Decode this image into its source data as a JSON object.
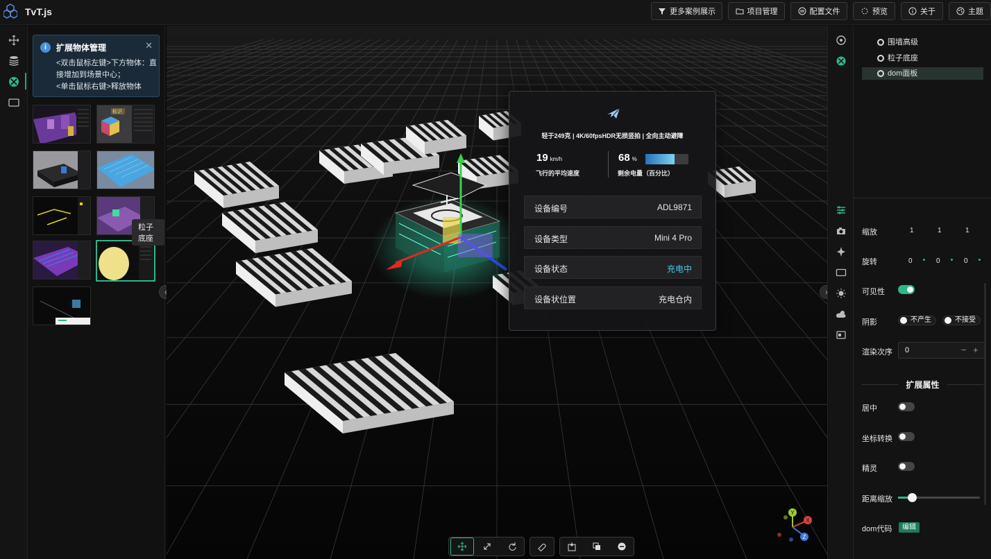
{
  "app": {
    "title": "TvT.js"
  },
  "toolbar": {
    "buttons": [
      {
        "label": "更多案例展示",
        "icon": "filter-icon"
      },
      {
        "label": "项目管理",
        "icon": "folder-icon"
      },
      {
        "label": "配置文件",
        "icon": "config-icon"
      },
      {
        "label": "预览",
        "icon": "preview-icon"
      },
      {
        "label": "关于",
        "icon": "info-icon"
      },
      {
        "label": "主题",
        "icon": "theme-icon"
      }
    ]
  },
  "left_panel": {
    "info": {
      "title": "扩展物体管理",
      "lines": [
        "<双击鼠标左键>下方物体：直",
        "接增加到场景中心；",
        "<单击鼠标右键>释放物体"
      ]
    },
    "thumb_tag": "标识",
    "tooltip": "粒子底座"
  },
  "device_popup": {
    "subtitle": "轻于249克 | 4K/60fpsHDR无损竖拍 | 全向主动避障",
    "speed": {
      "value": "19",
      "unit": "km/h",
      "label": "飞行的平均速度"
    },
    "battery": {
      "value": "68",
      "unit": "%",
      "label": "剩余电量（百分比）",
      "percent": 68
    },
    "rows": [
      {
        "key": "设备编号",
        "value": "ADL9871"
      },
      {
        "key": "设备类型",
        "value": "Mini 4 Pro"
      },
      {
        "key": "设备状态",
        "value": "充电中"
      },
      {
        "key": "设备状位置",
        "value": "充电仓内"
      }
    ]
  },
  "right_panel": {
    "tree": [
      "围墙高级",
      "粒子底座",
      "dom面板"
    ],
    "props": {
      "scale_label": "缩放",
      "scale": [
        "1",
        "1",
        "1"
      ],
      "rotate_label": "旋转",
      "rotate": [
        "0",
        "0",
        "0"
      ],
      "visible_label": "可见性",
      "shadow_label": "阴影",
      "shadow_cast": "不产生",
      "shadow_receive": "不接受",
      "render_order_label": "渲染次序",
      "render_order": "0",
      "render_minus": "−",
      "render_plus": "+"
    },
    "extend": {
      "title": "扩展属性",
      "center_label": "居中",
      "coord_label": "坐标转换",
      "sprite_label": "精灵",
      "distance_label": "距离缩放",
      "distance_value": 0.17,
      "dom_label": "dom代码",
      "edit_label": "编辑"
    }
  },
  "gizmo": {
    "x": "X",
    "y": "Y",
    "z": "Z"
  },
  "colors": {
    "accent": "#2fb58a",
    "highlight": "#4dc7e8",
    "info_bg": "#1a2a38"
  }
}
